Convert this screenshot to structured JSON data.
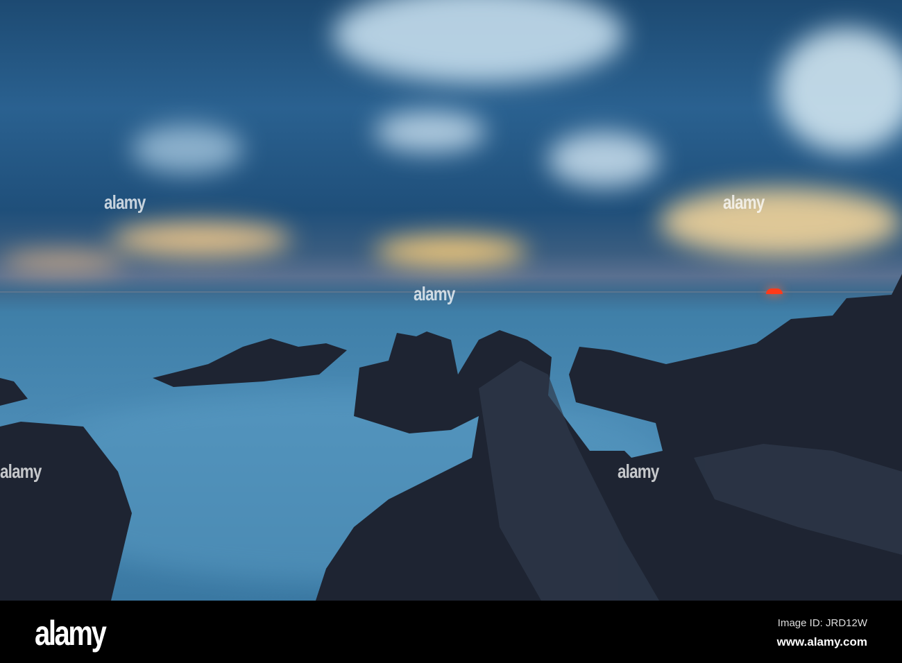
{
  "photo": {
    "description_alt": "Long exposure rocky coast at sunset",
    "colors": {
      "sky": "#1f4f7a",
      "sea": "#4a8ab4",
      "rock": "#1e2432",
      "sun": "#ff3a1a",
      "glow": "#f6c87a"
    }
  },
  "watermark": {
    "text": "alamy"
  },
  "footer": {
    "logo": "alamy",
    "image_id": "Image ID: JRD12W",
    "site": "www.alamy.com"
  }
}
